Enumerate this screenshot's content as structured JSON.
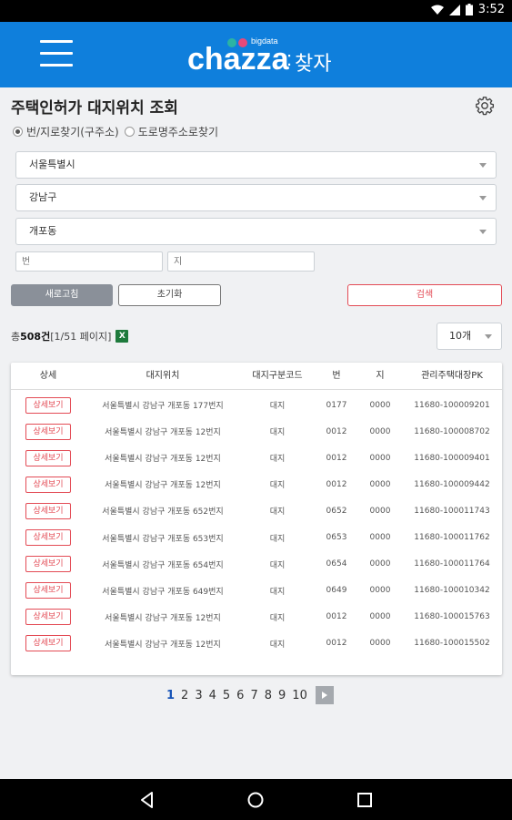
{
  "status_bar": {
    "time": "3:52"
  },
  "header": {
    "logo_small": "bigdata",
    "logo_main": "chazza",
    "logo_sep": ":",
    "logo_kor": "찾자",
    "logo_dot_colors": [
      "#2bb3a4",
      "#e8497a"
    ]
  },
  "page": {
    "title": "주택인허가 대지위치 조회"
  },
  "search": {
    "radio_options": [
      {
        "label": "번/지로찾기(구주소)",
        "checked": true
      },
      {
        "label": "도로명주소로찾기",
        "checked": false
      }
    ],
    "city": "서울특별시",
    "district": "강남구",
    "dong": "개포동",
    "bun_placeholder": "번",
    "ji_placeholder": "지",
    "refresh_label": "새로고침",
    "reset_label": "초기화",
    "search_label": "검색"
  },
  "results": {
    "total_prefix": "총 ",
    "total_count": "508건",
    "page_info": "[1/51 페이지]",
    "excel_icon": "X",
    "page_size": "10개"
  },
  "table": {
    "headers": [
      "상세",
      "대지위치",
      "대지구분코드",
      "번",
      "지",
      "관리주택대장PK"
    ],
    "detail_label": "상세보기",
    "rows": [
      {
        "address": "서울특별시 강남구 개포동 177번지",
        "code": "대지",
        "bun": "0177",
        "ji": "0000",
        "pk": "11680-100009201"
      },
      {
        "address": "서울특별시 강남구 개포동 12번지",
        "code": "대지",
        "bun": "0012",
        "ji": "0000",
        "pk": "11680-100008702"
      },
      {
        "address": "서울특별시 강남구 개포동 12번지",
        "code": "대지",
        "bun": "0012",
        "ji": "0000",
        "pk": "11680-100009401"
      },
      {
        "address": "서울특별시 강남구 개포동 12번지",
        "code": "대지",
        "bun": "0012",
        "ji": "0000",
        "pk": "11680-100009442"
      },
      {
        "address": "서울특별시 강남구 개포동 652번지",
        "code": "대지",
        "bun": "0652",
        "ji": "0000",
        "pk": "11680-100011743"
      },
      {
        "address": "서울특별시 강남구 개포동 653번지",
        "code": "대지",
        "bun": "0653",
        "ji": "0000",
        "pk": "11680-100011762"
      },
      {
        "address": "서울특별시 강남구 개포동 654번지",
        "code": "대지",
        "bun": "0654",
        "ji": "0000",
        "pk": "11680-100011764"
      },
      {
        "address": "서울특별시 강남구 개포동 649번지",
        "code": "대지",
        "bun": "0649",
        "ji": "0000",
        "pk": "11680-100010342"
      },
      {
        "address": "서울특별시 강남구 개포동 12번지",
        "code": "대지",
        "bun": "0012",
        "ji": "0000",
        "pk": "11680-100015763"
      },
      {
        "address": "서울특별시 강남구 개포동 12번지",
        "code": "대지",
        "bun": "0012",
        "ji": "0000",
        "pk": "11680-100015502"
      }
    ]
  },
  "pagination": {
    "pages": [
      "1",
      "2",
      "3",
      "4",
      "5",
      "6",
      "7",
      "8",
      "9",
      "10"
    ],
    "active": "1"
  },
  "colors": {
    "header_blue": "#0f7fdc",
    "accent_red": "#e34b55",
    "active_page": "#1a56b8"
  }
}
